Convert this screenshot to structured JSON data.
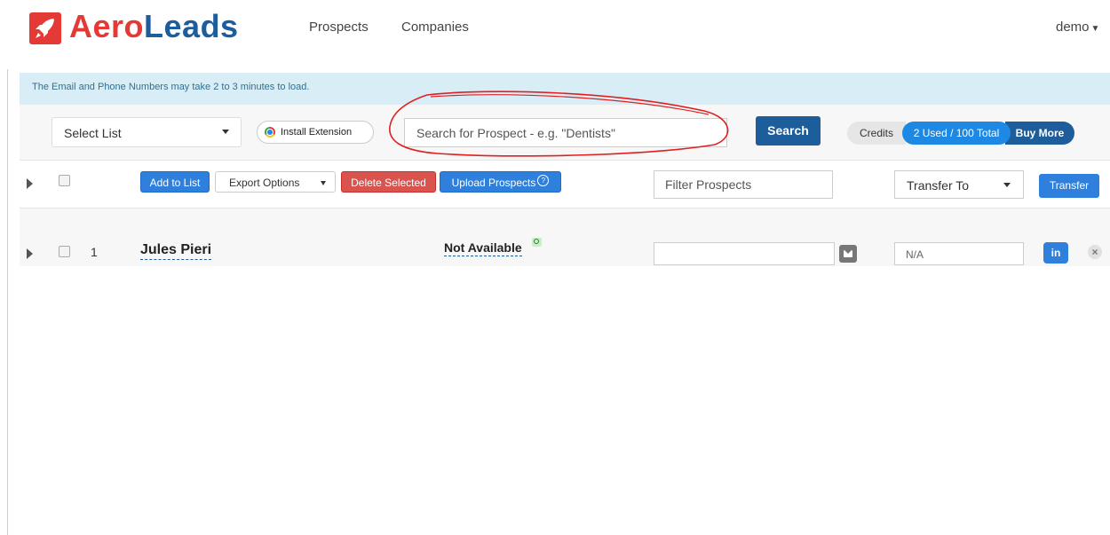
{
  "nav": {
    "logo": {
      "part1": "Aero",
      "part2": "Leads"
    },
    "links": [
      "Prospects",
      "Companies"
    ],
    "user": "demo"
  },
  "info_bar": {
    "text": "The Email and Phone Numbers may take 2 to 3 minutes to load."
  },
  "search_bar": {
    "select_list": "Select List",
    "install_extension": "Install Extension",
    "search_placeholder": "Search for Prospect - e.g. \"Dentists\"",
    "search_button": "Search",
    "credits_label": "Credits",
    "credits_used": "2 Used / 100 Total",
    "buy_more": "Buy More"
  },
  "actions": {
    "add_to_list": "Add to List",
    "export_options": "Export Options",
    "delete_selected": "Delete Selected",
    "upload_prospects": "Upload Prospects",
    "upload_help": "?",
    "filter_placeholder": "Filter Prospects",
    "transfer_to": "Transfer To",
    "transfer_button": "Transfer"
  },
  "rows": [
    {
      "index": "1",
      "name": "Jules Pieri",
      "status": "Not Available",
      "email": "",
      "transfer_value": "N/A",
      "linkedin_label": "in",
      "remove_label": "×"
    }
  ],
  "colors": {
    "brand_red": "#e53935",
    "brand_blue": "#1e5d9b",
    "accent_blue": "#2f7fdc",
    "danger": "#d9534f",
    "info_bg": "#d9edf7",
    "annotation": "#e02020"
  }
}
